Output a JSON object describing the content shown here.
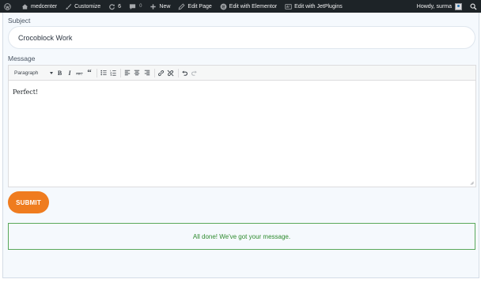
{
  "adminbar": {
    "site_name": "medcenter",
    "customize": "Customize",
    "updates_count": "6",
    "comments_count": "0",
    "new": "New",
    "edit_page": "Edit Page",
    "edit_elementor": "Edit with Elementor",
    "edit_jetplugins": "Edit with JetPlugins",
    "howdy": "Howdy, surma"
  },
  "form": {
    "subject_label": "Subject",
    "subject_value": "Crocoblock Work",
    "message_label": "Message",
    "format_select": "Paragraph",
    "message_content": "Perfect!",
    "submit_label": "SUBMIT",
    "success_message": "All done! We've got your message."
  },
  "colors": {
    "adminbar_bg": "#1d2327",
    "submit_bg": "#ef7c1f",
    "success_border": "#5aa85a",
    "success_text": "#2e8b2e"
  }
}
